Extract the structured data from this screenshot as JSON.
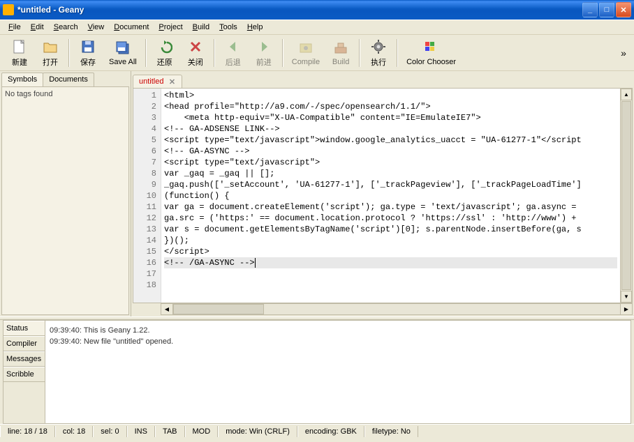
{
  "window": {
    "title": "*untitled - Geany"
  },
  "menubar": [
    "File",
    "Edit",
    "Search",
    "View",
    "Document",
    "Project",
    "Build",
    "Tools",
    "Help"
  ],
  "toolbar": {
    "new": "新建",
    "open": "打开",
    "save": "保存",
    "saveall": "Save All",
    "revert": "还原",
    "close": "关闭",
    "back": "后退",
    "forward": "前进",
    "compile": "Compile",
    "build": "Build",
    "run": "执行",
    "colorchooser": "Color Chooser"
  },
  "sidebar": {
    "tabs": [
      "Symbols",
      "Documents"
    ],
    "body": "No tags found"
  },
  "editor": {
    "tab": {
      "name": "untitled"
    },
    "lines": [
      "<html>",
      "<head profile=\"http://a9.com/-/spec/opensearch/1.1/\">",
      "    <meta http-equiv=\"X-UA-Compatible\" content=\"IE=EmulateIE7\">",
      "",
      "<!-- GA-ADSENSE LINK-->",
      "<script type=\"text/javascript\">window.google_analytics_uacct = \"UA-61277-1\"</script",
      "",
      "<!-- GA-ASYNC -->",
      "<script type=\"text/javascript\">",
      "var _gaq = _gaq || [];",
      "_gaq.push(['_setAccount', 'UA-61277-1'], ['_trackPageview'], ['_trackPageLoadTime']",
      "(function() {",
      "var ga = document.createElement('script'); ga.type = 'text/javascript'; ga.async =",
      "ga.src = ('https:' == document.location.protocol ? 'https://ssl' : 'http://www') +",
      "var s = document.getElementsByTagName('script')[0]; s.parentNode.insertBefore(ga, s",
      "})();",
      "</script>",
      "<!-- /GA-ASYNC -->"
    ]
  },
  "msgpanel": {
    "tabs": [
      "Status",
      "Compiler",
      "Messages",
      "Scribble"
    ],
    "lines": [
      "09:39:40: This is Geany 1.22.",
      "09:39:40: New file \"untitled\" opened."
    ]
  },
  "statusbar": {
    "line": "line: 18 / 18",
    "col": "col: 18",
    "sel": "sel: 0",
    "ins": "INS",
    "tab": "TAB",
    "mod": "MOD",
    "mode": "mode: Win (CRLF)",
    "encoding": "encoding: GBK",
    "filetype": "filetype: No"
  }
}
